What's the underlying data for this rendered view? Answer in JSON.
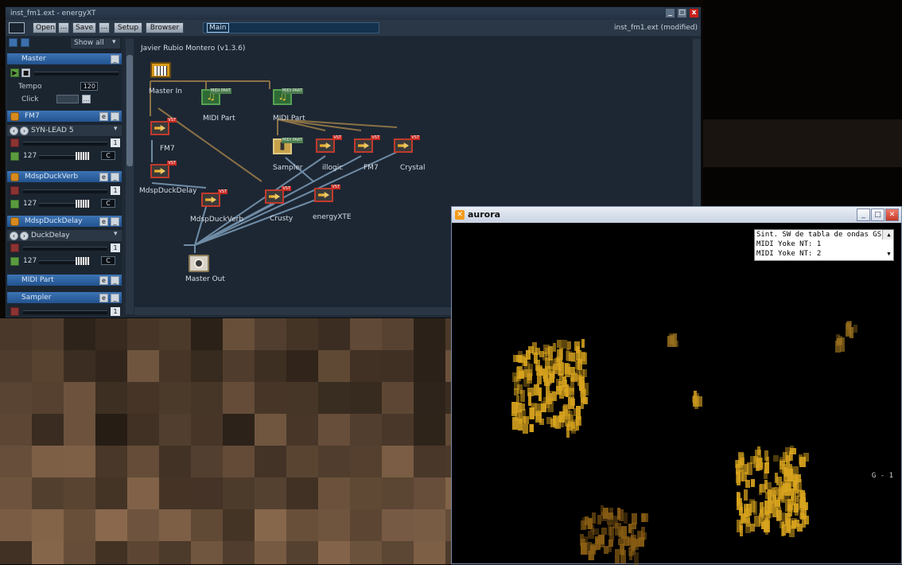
{
  "ext": {
    "title": "inst_fm1.ext - energyXT",
    "toolbar": {
      "open": "Open",
      "save": "Save",
      "setup": "Setup",
      "browser": "Browser",
      "dots": "...",
      "main": "Main",
      "status": "inst_fm1.ext (modified)"
    },
    "left": {
      "show_all": "Show all",
      "master": "Master",
      "tempo_label": "Tempo",
      "tempo_value": "120",
      "click_label": "Click",
      "tracks": [
        {
          "name": "FM7",
          "e": "e"
        },
        {
          "name": "SYN-LEAD 5"
        },
        {
          "name": "MdspDuckVerb",
          "e": "e"
        },
        {
          "name": "MdspDuckDelay",
          "e": "e"
        },
        {
          "name": "DuckDelay"
        },
        {
          "name": "MIDI Part",
          "e": "e"
        },
        {
          "name": "Sampler",
          "e": "e"
        }
      ],
      "level": "127",
      "channel": "1",
      "c": "C"
    },
    "canvas": {
      "author": "Javier Rubio Montero (v1.3.6)",
      "nodes": {
        "master_in": "Master In",
        "midi_part_1": "MIDI Part",
        "midi_part_2": "MIDI Part",
        "fm7_a": "FM7",
        "mdspduckdelay": "MdspDuckDelay",
        "mdspduckverb": "MdspDuckVerb",
        "sampler": "Sampler",
        "illogic": "illogic",
        "fm7_b": "FM7",
        "crystal": "Crystal",
        "crusty": "Crusty",
        "energyxte": "energyXTE",
        "master_out": "Master Out"
      },
      "tags": {
        "vst": "VST",
        "midi": "MIDI PART"
      }
    }
  },
  "aurora": {
    "title": "aurora",
    "midi_options": [
      "Sint. SW de tabla de ondas GS",
      "MIDI Yoke NT:  1",
      "MIDI Yoke NT:  2"
    ],
    "indicator": "G - 1"
  },
  "colors": {
    "accent": "#3d73b4",
    "vst_red": "#c23a2c",
    "midi_green": "#57a153",
    "aurora_gold": "#d9a41e"
  }
}
